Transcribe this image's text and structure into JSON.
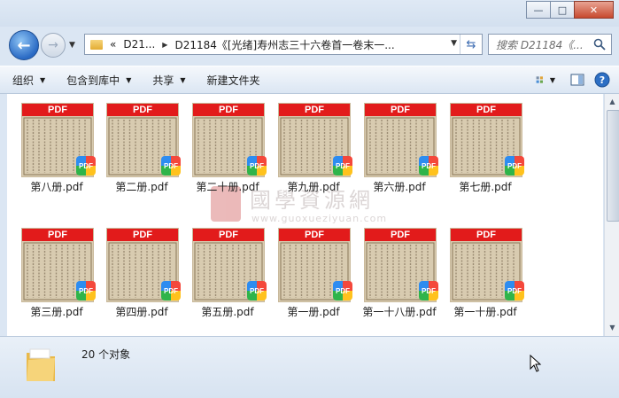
{
  "address": {
    "crumbs": [
      "D21...",
      "D21184《[光绪]寿州志三十六卷首一卷末一..."
    ],
    "chevron": "«"
  },
  "search": {
    "placeholder": "搜索 D21184《..."
  },
  "toolbar": {
    "organize": "组织",
    "include_library": "包含到库中",
    "share": "共享",
    "new_folder": "新建文件夹"
  },
  "files": [
    {
      "name": "第八册.pdf",
      "badge": "PDF"
    },
    {
      "name": "第二册.pdf",
      "badge": "PDF"
    },
    {
      "name": "第二十册.pdf",
      "badge": "PDF"
    },
    {
      "name": "第九册.pdf",
      "badge": "PDF"
    },
    {
      "name": "第六册.pdf",
      "badge": "PDF"
    },
    {
      "name": "第七册.pdf",
      "badge": "PDF"
    },
    {
      "name": "第三册.pdf",
      "badge": "PDF"
    },
    {
      "name": "第四册.pdf",
      "badge": "PDF"
    },
    {
      "name": "第五册.pdf",
      "badge": "PDF"
    },
    {
      "name": "第一册.pdf",
      "badge": "PDF"
    },
    {
      "name": "第一十八册.pdf",
      "badge": "PDF"
    },
    {
      "name": "第一十册.pdf",
      "badge": "PDF"
    }
  ],
  "watermark": {
    "title": "國學資源網",
    "url": "www.guoxueziyuan.com"
  },
  "status": {
    "count": "20 个对象"
  },
  "colors": {
    "pdf_banner": "#e21b1b",
    "window": "#dbe6f3"
  }
}
